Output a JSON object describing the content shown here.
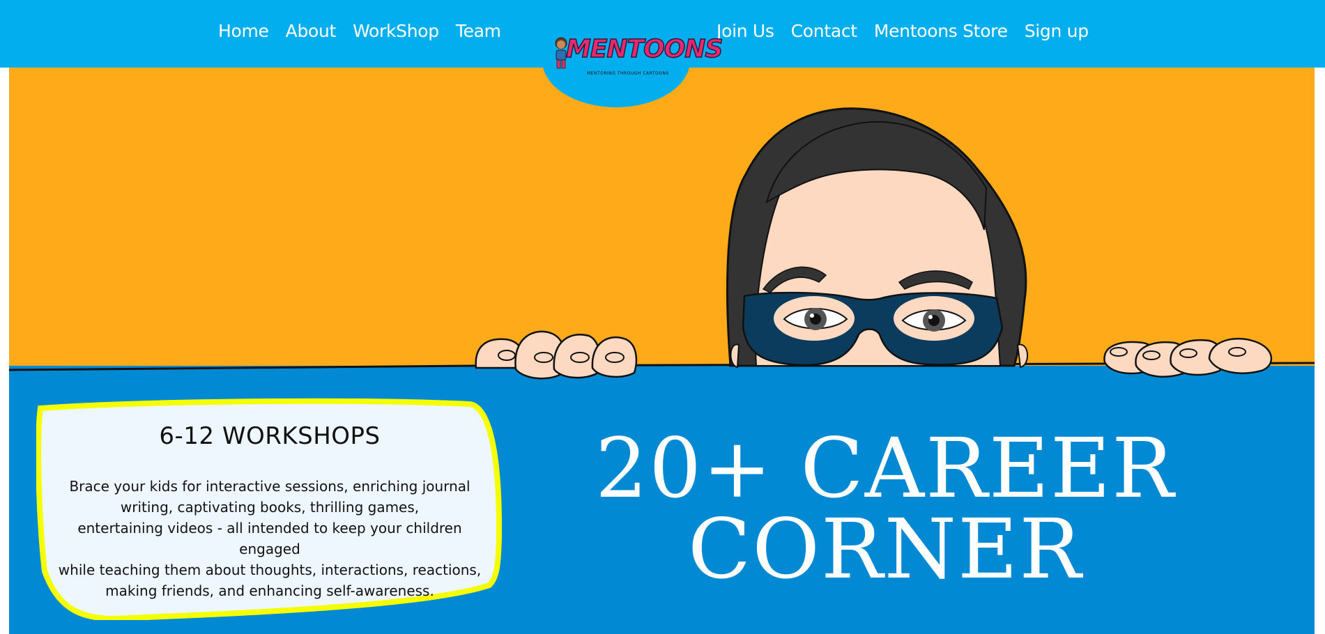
{
  "nav": {
    "left": [
      {
        "label": "Home"
      },
      {
        "label": "About"
      },
      {
        "label": "WorkShop"
      },
      {
        "label": "Team"
      }
    ],
    "right": [
      {
        "label": "Join Us"
      },
      {
        "label": "Contact"
      },
      {
        "label": "Mentoons Store"
      },
      {
        "label": "Sign up"
      }
    ]
  },
  "logo": {
    "wordmark": "MENTOONS",
    "tagline": "MENTORING THROUGH CARTOONS"
  },
  "workshop_card": {
    "title": "6-12 WORKSHOPS",
    "lines": [
      "Brace your kids for interactive sessions, enriching journal",
      "writing, captivating books, thrilling games,",
      "entertaining videos - all intended to keep your children",
      "engaged",
      "while teaching them about thoughts, interactions, reactions,",
      "making friends, and enhancing self-awareness."
    ]
  },
  "headline": {
    "line1": "20+ CAREER",
    "line2": "CORNER"
  },
  "colors": {
    "header": "#03aeee",
    "hero_orange": "#ffab19",
    "hero_blue": "#0289d3",
    "card_border": "#f6ff00",
    "card_fill": "#eef7fd",
    "logo_pink": "#e8286c"
  }
}
